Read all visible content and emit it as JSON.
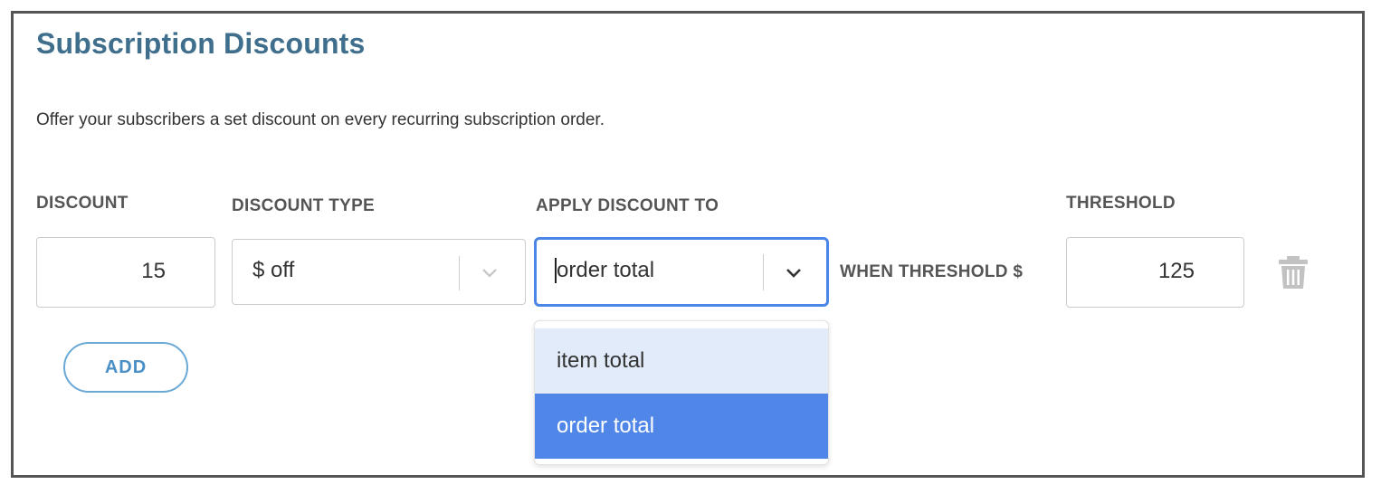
{
  "panel": {
    "title": "Subscription Discounts",
    "description": "Offer your subscribers a set discount on every recurring subscription order."
  },
  "labels": {
    "discount": "DISCOUNT",
    "discount_type": "DISCOUNT TYPE",
    "apply_discount_to": "APPLY DISCOUNT TO",
    "threshold": "THRESHOLD",
    "when_threshold": "WHEN THRESHOLD $"
  },
  "fields": {
    "discount_value": "15",
    "discount_type_value": "$ off",
    "apply_to_value": "order total",
    "threshold_value": "125"
  },
  "dropdown": {
    "options": [
      {
        "label": "item total",
        "state": "hovered"
      },
      {
        "label": "order total",
        "state": "selected"
      }
    ]
  },
  "buttons": {
    "add": "ADD"
  },
  "icons": {
    "trash": "trash-icon",
    "chevron": "chevron-down-icon"
  },
  "colors": {
    "title": "#3f6f8d",
    "focus_border": "#4a86e8",
    "option_selected": "#4f86e8",
    "option_hover": "#e2ebfa",
    "add_button": "#4a8fc6"
  }
}
